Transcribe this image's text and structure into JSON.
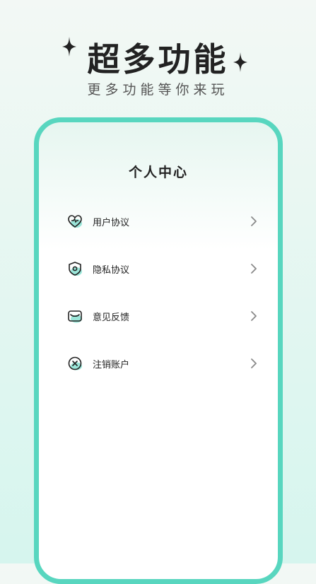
{
  "headline": {
    "title": "超多功能",
    "subtitle": "更多功能等你来玩"
  },
  "screen": {
    "title": "个人中心",
    "menu_items": [
      {
        "label": "用户协议",
        "icon": "heart-shield-icon"
      },
      {
        "label": "隐私协议",
        "icon": "privacy-shield-icon"
      },
      {
        "label": "意见反馈",
        "icon": "mail-icon"
      },
      {
        "label": "注销账户",
        "icon": "close-circle-icon"
      }
    ]
  },
  "colors": {
    "accent": "#58d6bf",
    "text": "#222222",
    "chevron": "#8a8a8a"
  }
}
